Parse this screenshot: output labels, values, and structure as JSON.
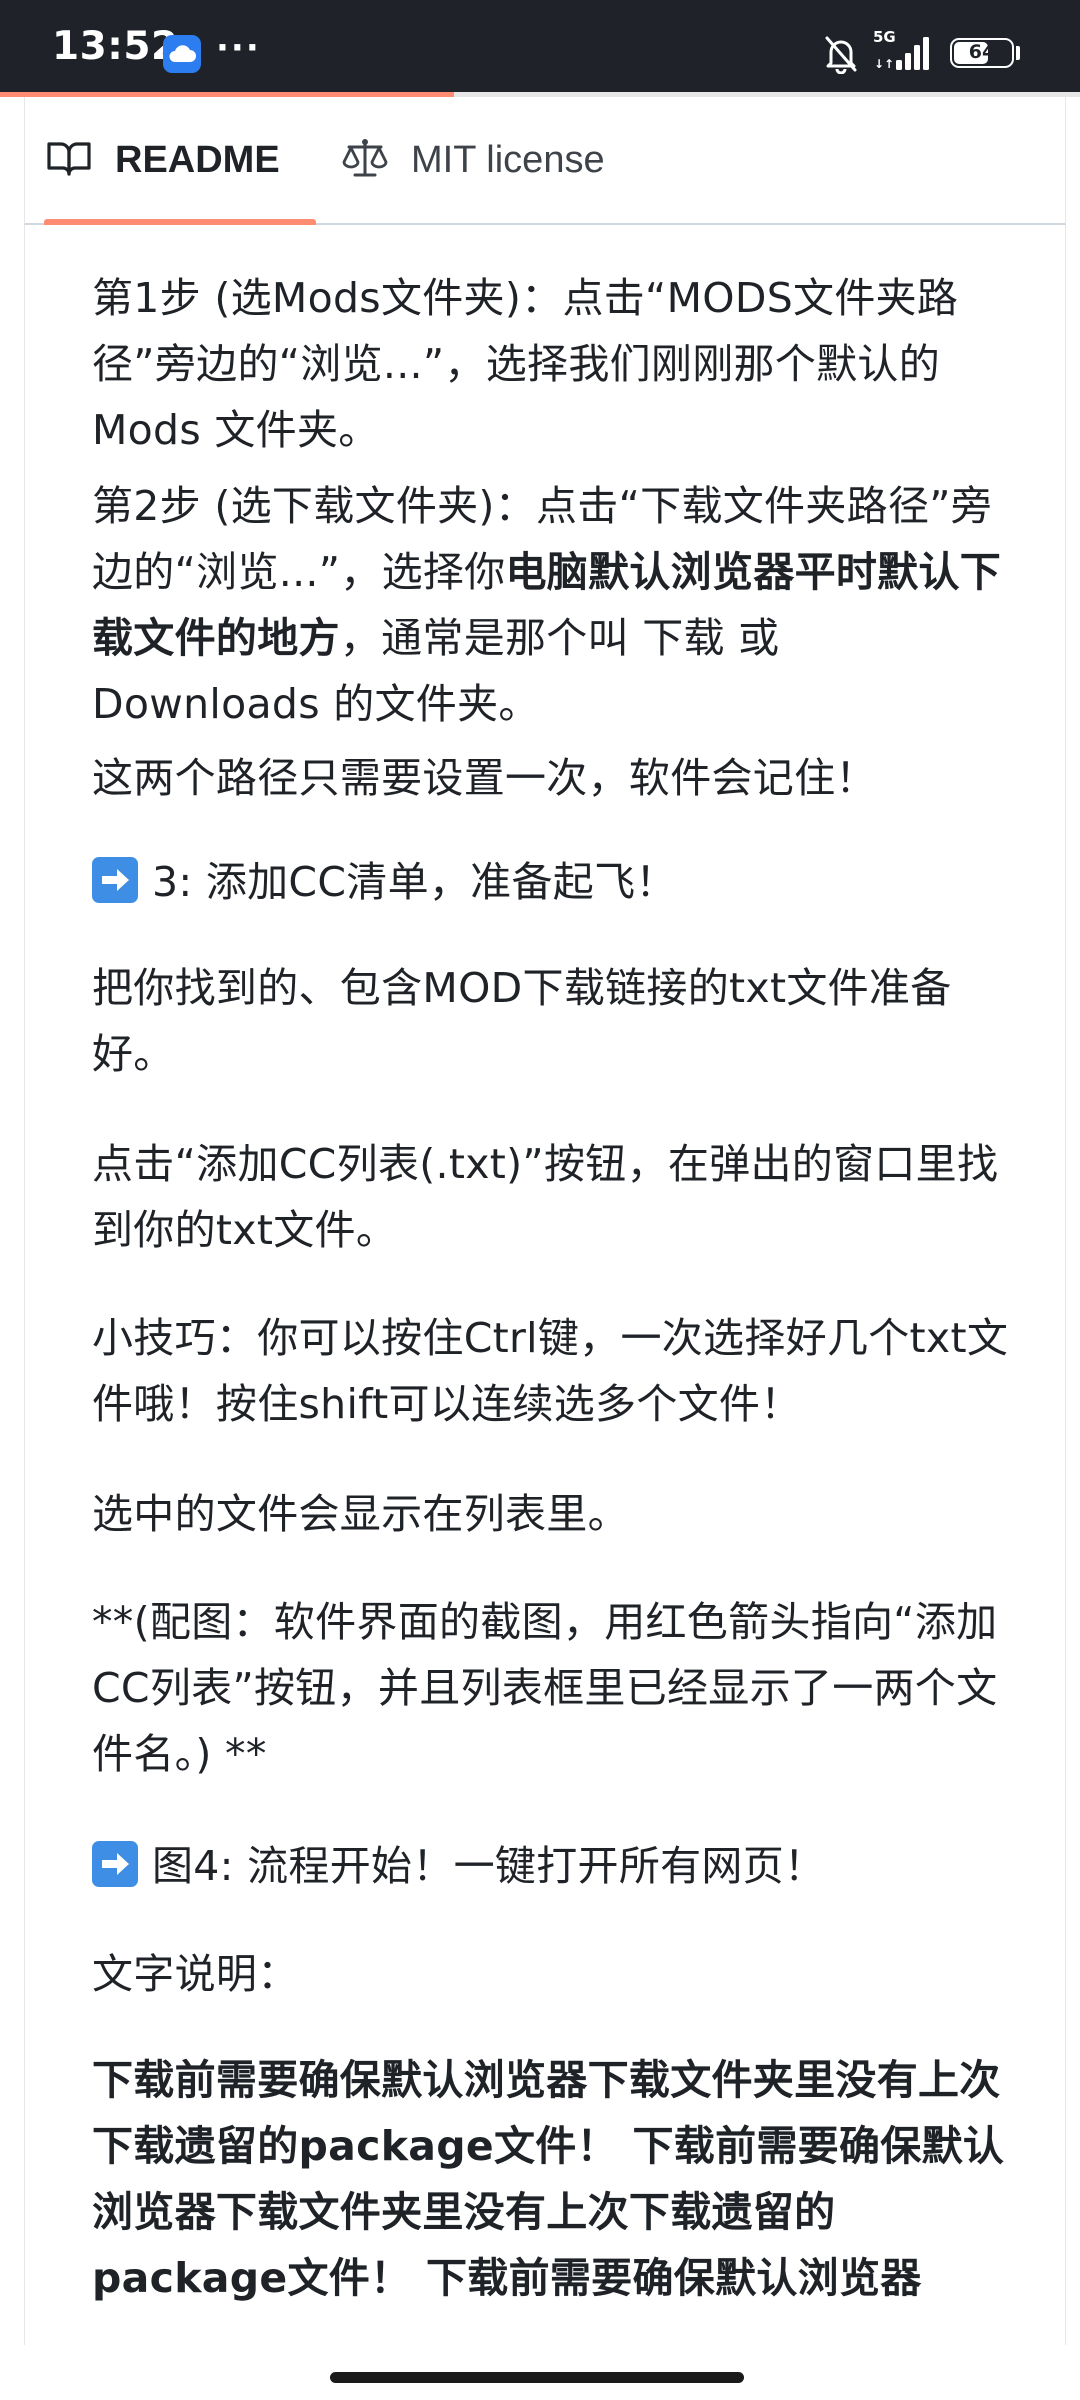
{
  "status_bar": {
    "time": "13:52",
    "dots": "···",
    "network_type": "5G",
    "battery_level": "64",
    "battery_fraction": 0.64,
    "icons": [
      "cloud-app-icon",
      "bell-off-icon",
      "signal-icon",
      "battery-icon"
    ]
  },
  "page": {
    "scroll_progress": 0.42
  },
  "tabs": [
    {
      "label": "README",
      "icon": "book-icon",
      "active": true
    },
    {
      "label": "MIT license",
      "icon": "scale-icon",
      "active": false
    }
  ],
  "readme": {
    "step1": "第1步 (选Mods文件夹)：点击“MODS文件夹路径”旁边的“浏览...”，选择我们刚刚那个默认的Mods 文件夹。",
    "step2_before": "第2步 (选下载文件夹)：点击“下载文件夹路径”旁边的“浏览...”，选择你",
    "step2_bold": "电脑默认浏览器平时默认下载文件的地方",
    "step2_after": "，通常是那个叫 下载 或 Downloads 的文件夹。",
    "remember": "这两个路径只需要设置一次，软件会记住！",
    "heading3": "3: 添加CC清单，准备起飞！",
    "prepare_txt": "把你找到的、包含MOD下载链接的txt文件准备好。",
    "click_add": "点击“添加CC列表(.txt)”按钮，在弹出的窗口里找到你的txt文件。",
    "tip": "小技巧：你可以按住Ctrl键，一次选择好几个txt文件哦！按住shift可以连续选多个文件！",
    "shown_in_list": "选中的文件会显示在列表里。",
    "image_note": "**(配图：软件界面的截图，用红色箭头指向“添加CC列表”按钮，并且列表框里已经显示了一两个文件名。) **",
    "heading4": "图4: 流程开始！一键打开所有网页！",
    "text_desc": "文字说明：",
    "warning": "下载前需要确保默认浏览器下载文件夹里没有上次下载遗留的package文件！ 下载前需要确保默认浏览器下载文件夹里没有上次下载遗留的package文件！ 下载前需要确保默认浏览器"
  }
}
